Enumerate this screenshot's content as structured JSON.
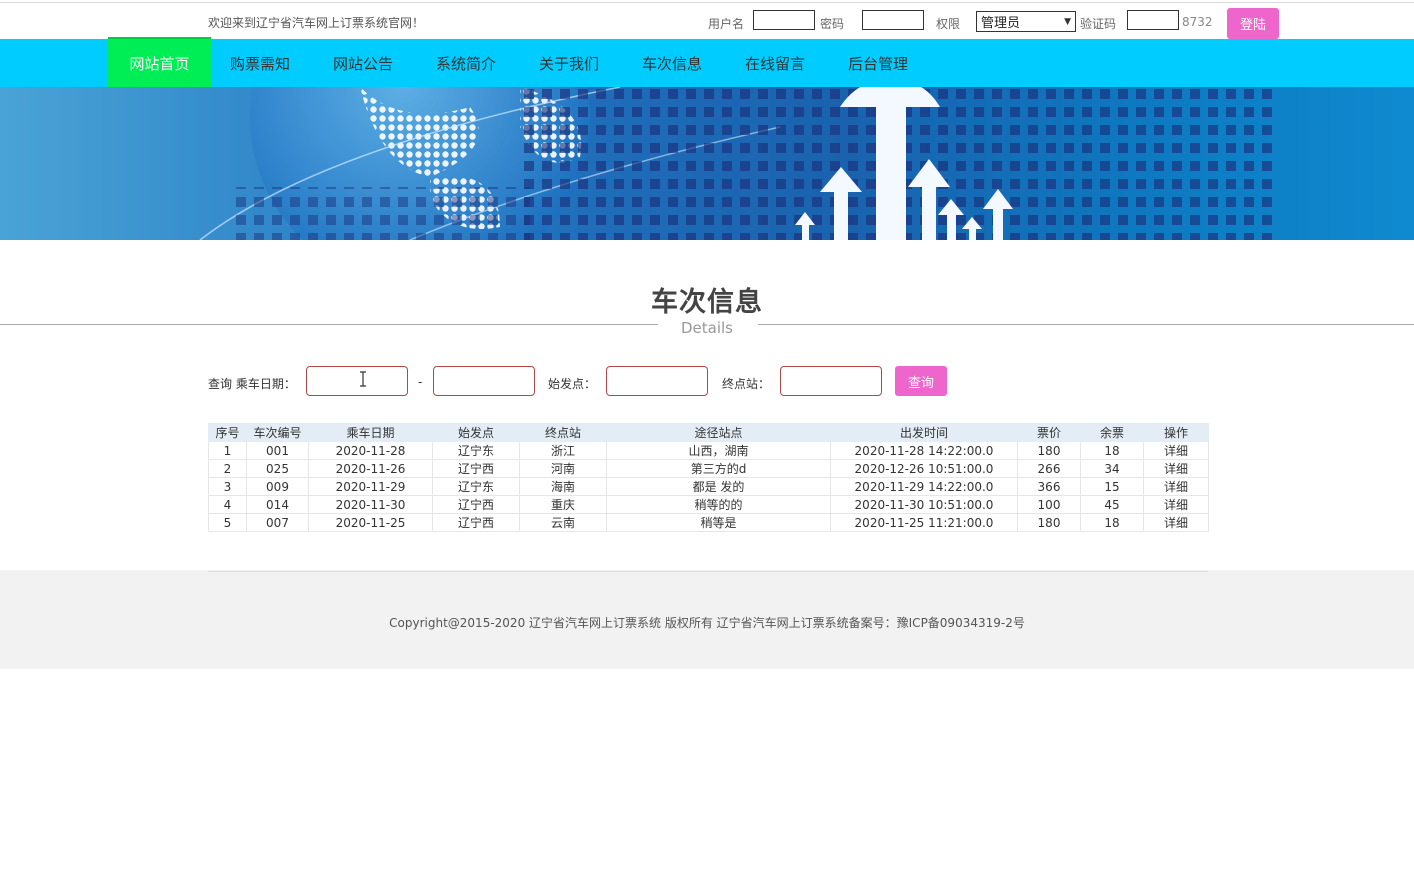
{
  "header": {
    "welcome": "欢迎来到辽宁省汽车网上订票系统官网！",
    "username_label": "用户名",
    "password_label": "密码",
    "role_label": "权限",
    "role_value": "管理员",
    "captcha_label": "验证码",
    "captcha_code": "8732",
    "login_button": "登陆"
  },
  "nav": {
    "items": [
      "网站首页",
      "购票需知",
      "网站公告",
      "系统简介",
      "关于我们",
      "车次信息",
      "在线留言",
      "后台管理"
    ]
  },
  "section": {
    "title": "车次信息",
    "subtitle": "Details"
  },
  "search": {
    "date_label": "查询 乘车日期：",
    "dash": "-",
    "origin_label": "始发点：",
    "destination_label": "终点站：",
    "button": "查询"
  },
  "table": {
    "headers": [
      "序号",
      "车次编号",
      "乘车日期",
      "始发点",
      "终点站",
      "途径站点",
      "出发时间",
      "票价",
      "余票",
      "操作"
    ],
    "rows": [
      [
        "1",
        "001",
        "2020-11-28",
        "辽宁东",
        "浙江",
        "山西，湖南",
        "2020-11-28 14:22:00.0",
        "180",
        "18",
        "详细"
      ],
      [
        "2",
        "025",
        "2020-11-26",
        "辽宁西",
        "河南",
        "第三方的d",
        "2020-12-26 10:51:00.0",
        "266",
        "34",
        "详细"
      ],
      [
        "3",
        "009",
        "2020-11-29",
        "辽宁东",
        "海南",
        "都是 发的",
        "2020-11-29 14:22:00.0",
        "366",
        "15",
        "详细"
      ],
      [
        "4",
        "014",
        "2020-11-30",
        "辽宁西",
        "重庆",
        "稍等的的",
        "2020-11-30 10:51:00.0",
        "100",
        "45",
        "详细"
      ],
      [
        "5",
        "007",
        "2020-11-25",
        "辽宁西",
        "云南",
        "稍等是",
        "2020-11-25 11:21:00.0",
        "180",
        "18",
        "详细"
      ]
    ]
  },
  "footer": {
    "copyright": "Copyright@2015-2020 辽宁省汽车网上订票系统 版权所有 辽宁省汽车网上订票系统备案号：豫ICP备09034319-2号"
  },
  "colors": {
    "nav_bg": "#00ccff",
    "nav_active": "#00ee55",
    "button_pink": "#ee66cc"
  }
}
